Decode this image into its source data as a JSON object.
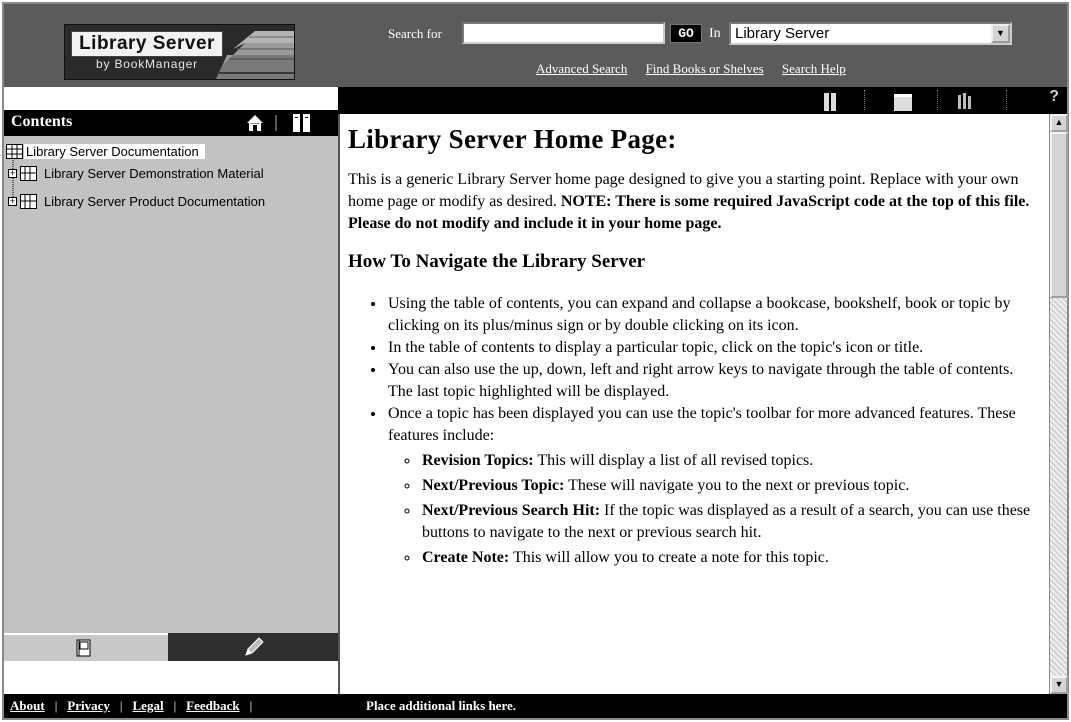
{
  "header": {
    "logo_title": "Library Server",
    "logo_subtitle": "by BookManager",
    "search_label": "Search for",
    "search_value": "",
    "go_label": "GO",
    "in_label": "In",
    "scope_selected": "Library Server",
    "links": [
      "Advanced Search",
      "Find Books or Shelves",
      "Search Help"
    ]
  },
  "sidebar": {
    "title": "Contents",
    "items": [
      {
        "label": "Library Server Documentation"
      },
      {
        "label": "Library Server Demonstration Material"
      },
      {
        "label": "Library Server Product Documentation"
      }
    ]
  },
  "toolbar": {
    "help_label": "?"
  },
  "main": {
    "title": "Library Server Home Page:",
    "intro_plain": "This is a generic Library Server home page designed to give you a starting point. Replace with your own home page or modify as desired.",
    "intro_bold": "NOTE: There is some required JavaScript code at the top of this file. Please do not modify and include it in your home page.",
    "nav_heading": "How To Navigate the Library Server",
    "bullets": [
      "Using the table of contents, you can expand and collapse a bookcase, bookshelf, book or topic by clicking on its plus/minus sign or by double clicking on its icon.",
      "In the table of contents to display a particular topic, click on the topic's icon or title.",
      "You can also use the up, down, left and right arrow keys to navigate through the table of contents. The last topic highlighted will be displayed.",
      "Once a topic has been displayed you can use the topic's toolbar for more advanced features. These features include:"
    ],
    "features": [
      {
        "name": "Revision Topics:",
        "text": "This will display a list of all revised topics."
      },
      {
        "name": "Next/Previous Topic:",
        "text": "These will navigate you to the next or previous topic."
      },
      {
        "name": "Next/Previous Search Hit:",
        "text": "If the topic was displayed as a result of a search, you can use these buttons to navigate to the next or previous search hit."
      },
      {
        "name": "Create Note:",
        "text": "This will allow you to create a note for this topic."
      }
    ]
  },
  "footer": {
    "links": [
      "About",
      "Privacy",
      "Legal",
      "Feedback"
    ],
    "note": "Place additional links here."
  }
}
